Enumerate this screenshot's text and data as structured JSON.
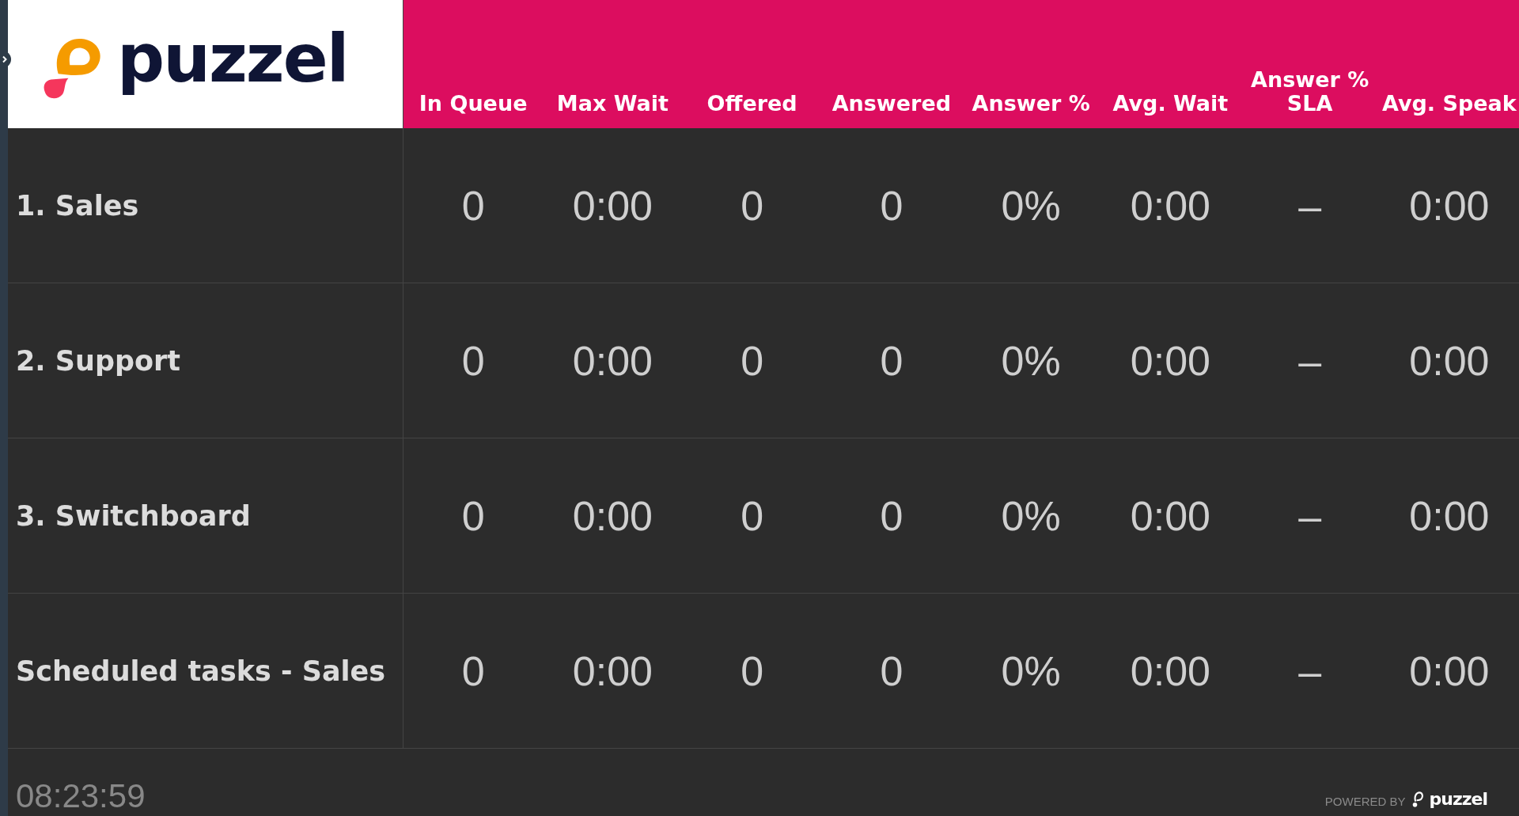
{
  "logo": {
    "text": "puzzel"
  },
  "columns": [
    "In Queue",
    "Max Wait",
    "Offered",
    "Answered",
    "Answer %",
    "Avg. Wait",
    "Answer % SLA",
    "Avg. Speak"
  ],
  "rows": [
    {
      "name": "1. Sales",
      "values": [
        "0",
        "0:00",
        "0",
        "0",
        "0%",
        "0:00",
        "–",
        "0:00"
      ]
    },
    {
      "name": "2. Support",
      "values": [
        "0",
        "0:00",
        "0",
        "0",
        "0%",
        "0:00",
        "–",
        "0:00"
      ]
    },
    {
      "name": "3. Switchboard",
      "values": [
        "0",
        "0:00",
        "0",
        "0",
        "0%",
        "0:00",
        "–",
        "0:00"
      ]
    },
    {
      "name": "Scheduled tasks - Sales",
      "values": [
        "0",
        "0:00",
        "0",
        "0",
        "0%",
        "0:00",
        "–",
        "0:00"
      ]
    }
  ],
  "footer": {
    "clock": "08:23:59",
    "powered_by": "POWERED BY",
    "brand": "puzzel"
  }
}
